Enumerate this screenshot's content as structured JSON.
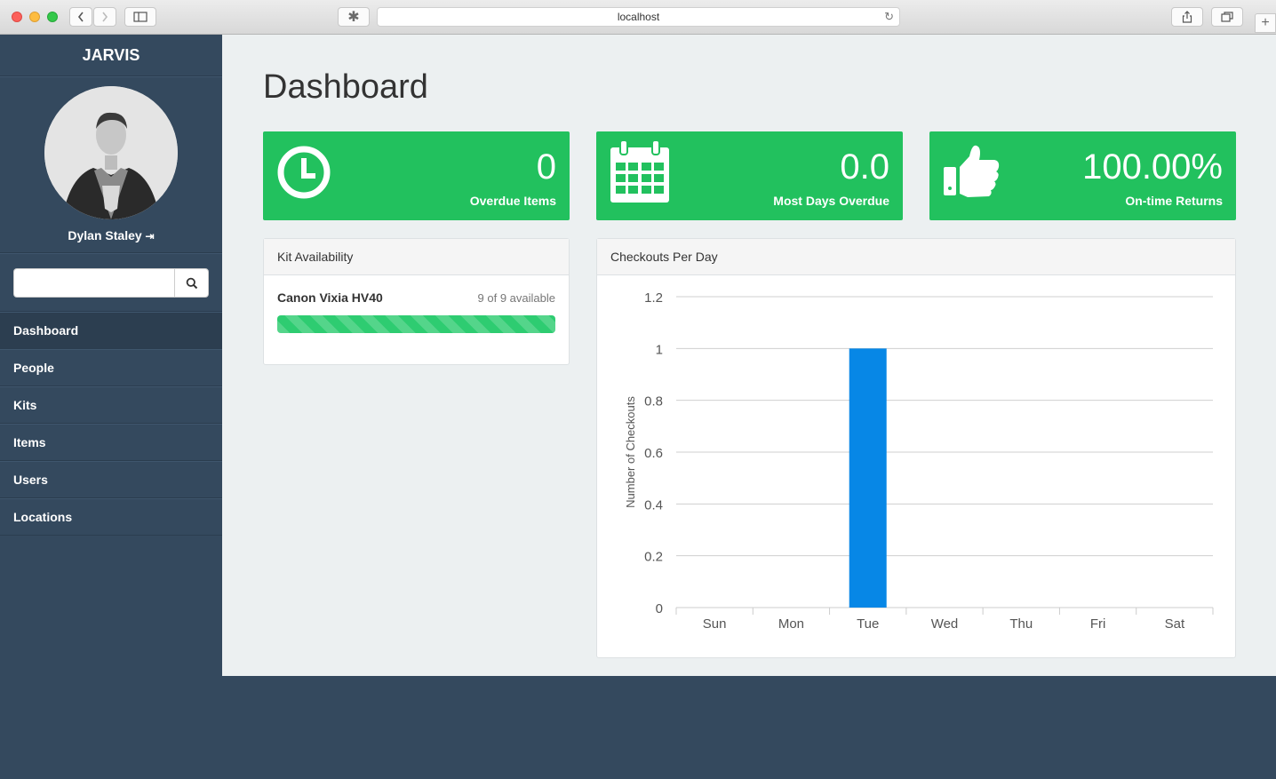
{
  "browser": {
    "url": "localhost"
  },
  "sidebar": {
    "brand": "JARVIS",
    "user_name": "Dylan Staley",
    "search_placeholder": "",
    "items": [
      {
        "label": "Dashboard",
        "active": true
      },
      {
        "label": "People"
      },
      {
        "label": "Kits"
      },
      {
        "label": "Items"
      },
      {
        "label": "Users"
      },
      {
        "label": "Locations"
      }
    ]
  },
  "main": {
    "title": "Dashboard",
    "stats": [
      {
        "value": "0",
        "label": "Overdue Items",
        "icon": "clock-icon"
      },
      {
        "value": "0.0",
        "label": "Most Days Overdue",
        "icon": "calendar-icon"
      },
      {
        "value": "100.00%",
        "label": "On-time Returns",
        "icon": "thumbs-up-icon"
      }
    ],
    "kit_panel": {
      "title": "Kit Availability",
      "kit": {
        "name": "Canon Vixia HV40",
        "availability": "9 of 9 available",
        "progress": 1.0
      }
    },
    "chart_panel": {
      "title": "Checkouts Per Day"
    }
  },
  "colors": {
    "accent_green": "#22c15e",
    "sidebar": "#34495e",
    "bar": "#0787e6"
  },
  "chart_data": {
    "type": "bar",
    "categories": [
      "Sun",
      "Mon",
      "Tue",
      "Wed",
      "Thu",
      "Fri",
      "Sat"
    ],
    "values": [
      0,
      0,
      1,
      0,
      0,
      0,
      0
    ],
    "ylabel": "Number of Checkouts",
    "ylim": [
      0,
      1.2
    ],
    "yticks": [
      "0",
      "0.2",
      "0.4",
      "0.6",
      "0.8",
      "1",
      "1.2"
    ],
    "grid": true
  }
}
